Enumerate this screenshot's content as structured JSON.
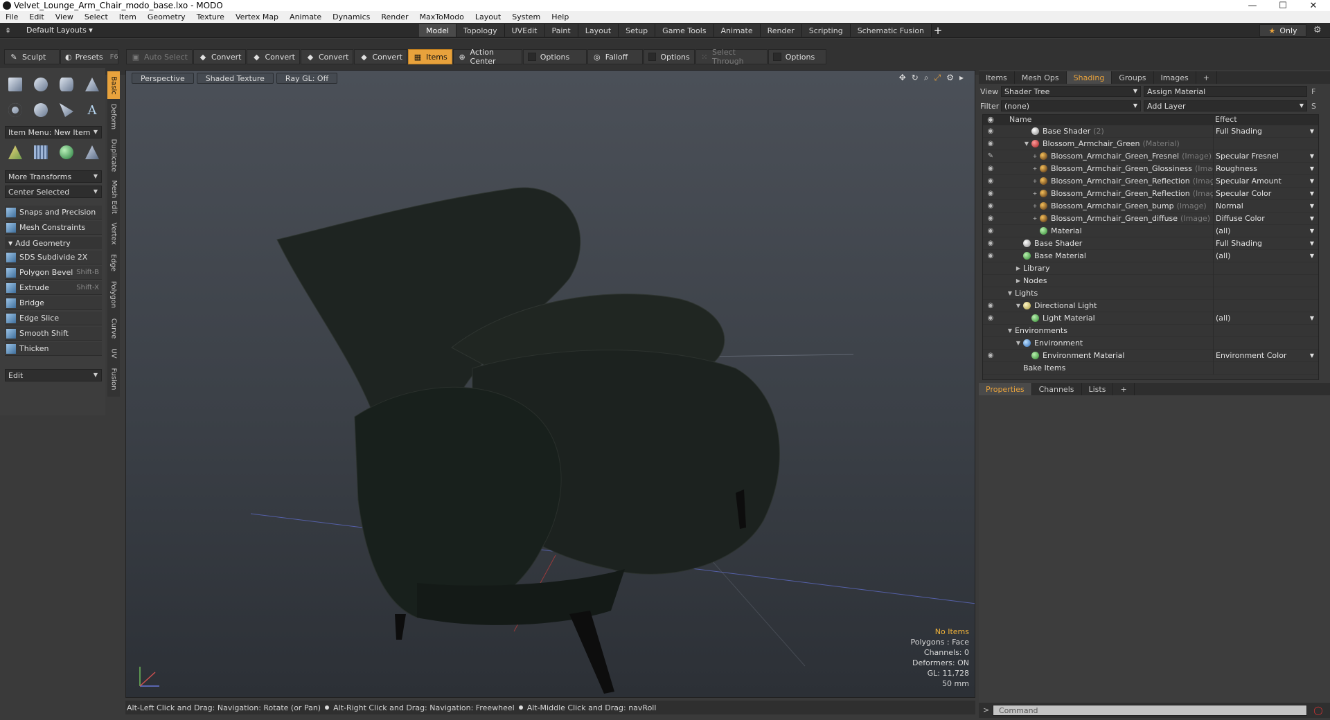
{
  "window": {
    "title": "Velvet_Lounge_Arm_Chair_modo_base.lxo - MODO",
    "controls": [
      "—",
      "☐",
      "✕"
    ]
  },
  "menu": [
    "File",
    "Edit",
    "View",
    "Select",
    "Item",
    "Geometry",
    "Texture",
    "Vertex Map",
    "Animate",
    "Dynamics",
    "Render",
    "MaxToModo",
    "Layout",
    "System",
    "Help"
  ],
  "layout_bar": {
    "default_layouts": "Default Layouts ▾",
    "tabs": [
      "Model",
      "Topology",
      "UVEdit",
      "Paint",
      "Layout",
      "Setup",
      "Game Tools",
      "Animate",
      "Render",
      "Scripting",
      "Schematic Fusion"
    ],
    "active_tab": "Model",
    "plus": "+",
    "only": "Only"
  },
  "toolbar": {
    "sculpt": "Sculpt",
    "presets": "Presets",
    "presets_hotkey": "F6",
    "auto_select": "Auto Select",
    "convert1": "Convert",
    "convert2": "Convert",
    "convert3": "Convert",
    "convert4": "Convert",
    "items": "Items",
    "action_center": "Action Center",
    "options1": "Options",
    "falloff": "Falloff",
    "options2": "Options",
    "select_through": "Select Through",
    "options3": "Options"
  },
  "left_panel": {
    "vertical_tabs": [
      "Basic",
      "Deform",
      "Duplicate",
      "Mesh Edit",
      "Vertex",
      "Edge",
      "Polygon",
      "Curve",
      "UV",
      "Fusion"
    ],
    "item_menu": "Item Menu: New Item",
    "more_transforms": "More Transforms",
    "center_selected": "Center Selected",
    "snaps": "Snaps and Precision",
    "mesh_constraints": "Mesh Constraints",
    "add_geometry": "Add Geometry",
    "tools": [
      {
        "label": "SDS Subdivide 2X",
        "hotkey": ""
      },
      {
        "label": "Polygon Bevel",
        "hotkey": "Shift-B"
      },
      {
        "label": "Extrude",
        "hotkey": "Shift-X"
      },
      {
        "label": "Bridge",
        "hotkey": ""
      },
      {
        "label": "Edge Slice",
        "hotkey": ""
      },
      {
        "label": "Smooth Shift",
        "hotkey": ""
      },
      {
        "label": "Thicken",
        "hotkey": ""
      }
    ],
    "edit": "Edit"
  },
  "viewport": {
    "perspective": "Perspective",
    "shaded_texture": "Shaded Texture",
    "ray_gl": "Ray GL: Off",
    "stats": {
      "no_items": "No Items",
      "polygons": "Polygons : Face",
      "channels": "Channels: 0",
      "deformers": "Deformers: ON",
      "gl": "GL: 11,728",
      "scale": "50 mm"
    }
  },
  "status_bar": {
    "hint1": "Alt-Left Click and Drag: Navigation: Rotate (or Pan)",
    "hint2": "Alt-Right Click and Drag: Navigation: Freewheel",
    "hint3": "Alt-Middle Click and Drag: navRoll"
  },
  "right_panel": {
    "tabs": [
      "Items",
      "Mesh Ops",
      "Shading",
      "Groups",
      "Images",
      "+"
    ],
    "active_tab": "Shading",
    "view_label": "View",
    "view_value": "Shader Tree",
    "assign_material": "Assign Material",
    "filter_label": "Filter",
    "filter_value": "(none)",
    "add_layer": "Add Layer",
    "col_name": "Name",
    "col_effect": "Effect",
    "tree": [
      {
        "name": "Base Shader",
        "tag": "(2)",
        "effect": "Full Shading",
        "indent": 2,
        "icon": "white",
        "twisty": "",
        "eye": "◉"
      },
      {
        "name": "Blossom_Armchair_Green",
        "tag": "(Material)",
        "effect": "",
        "indent": 2,
        "icon": "red",
        "twisty": "▼",
        "eye": "◉"
      },
      {
        "name": "Blossom_Armchair_Green_Fresnel",
        "tag": "(Image)",
        "effect": "Specular Fresnel",
        "indent": 3,
        "icon": "img",
        "twisty": "+",
        "eye": "✎"
      },
      {
        "name": "Blossom_Armchair_Green_Glossiness",
        "tag": "(Image)",
        "effect": "Roughness",
        "indent": 3,
        "icon": "img",
        "twisty": "+",
        "eye": "◉"
      },
      {
        "name": "Blossom_Armchair_Green_Reflection",
        "tag": "(Image...",
        "effect": "Specular Amount",
        "indent": 3,
        "icon": "img",
        "twisty": "+",
        "eye": "◉"
      },
      {
        "name": "Blossom_Armchair_Green_Reflection",
        "tag": "(Image)",
        "effect": "Specular Color",
        "indent": 3,
        "icon": "img",
        "twisty": "+",
        "eye": "◉"
      },
      {
        "name": "Blossom_Armchair_Green_bump",
        "tag": "(Image)",
        "effect": "Normal",
        "indent": 3,
        "icon": "img",
        "twisty": "+",
        "eye": "◉"
      },
      {
        "name": "Blossom_Armchair_Green_diffuse",
        "tag": "(Image)",
        "effect": "Diffuse Color",
        "indent": 3,
        "icon": "img",
        "twisty": "+",
        "eye": "◉"
      },
      {
        "name": "Material",
        "tag": "",
        "effect": "(all)",
        "indent": 3,
        "icon": "green",
        "twisty": "",
        "eye": "◉"
      },
      {
        "name": "Base Shader",
        "tag": "",
        "effect": "Full Shading",
        "indent": 1,
        "icon": "white",
        "twisty": "",
        "eye": "◉"
      },
      {
        "name": "Base Material",
        "tag": "",
        "effect": "(all)",
        "indent": 1,
        "icon": "green",
        "twisty": "",
        "eye": "◉"
      },
      {
        "name": "Library",
        "tag": "",
        "effect": "",
        "indent": 1,
        "icon": "",
        "twisty": "▶",
        "eye": ""
      },
      {
        "name": "Nodes",
        "tag": "",
        "effect": "",
        "indent": 1,
        "icon": "",
        "twisty": "▶",
        "eye": ""
      },
      {
        "name": "Lights",
        "tag": "",
        "effect": "",
        "indent": 0,
        "icon": "",
        "twisty": "▼",
        "eye": ""
      },
      {
        "name": "Directional Light",
        "tag": "",
        "effect": "",
        "indent": 1,
        "icon": "light",
        "twisty": "▼",
        "eye": "◉"
      },
      {
        "name": "Light Material",
        "tag": "",
        "effect": "(all)",
        "indent": 2,
        "icon": "green",
        "twisty": "",
        "eye": "◉"
      },
      {
        "name": "Environments",
        "tag": "",
        "effect": "",
        "indent": 0,
        "icon": "",
        "twisty": "▼",
        "eye": ""
      },
      {
        "name": "Environment",
        "tag": "",
        "effect": "",
        "indent": 1,
        "icon": "env",
        "twisty": "▼",
        "eye": ""
      },
      {
        "name": "Environment Material",
        "tag": "",
        "effect": "Environment Color",
        "indent": 2,
        "icon": "green",
        "twisty": "",
        "eye": "◉"
      },
      {
        "name": "Bake Items",
        "tag": "",
        "effect": "",
        "indent": 1,
        "icon": "",
        "twisty": "",
        "eye": ""
      }
    ],
    "props_tabs": [
      "Properties",
      "Channels",
      "Lists",
      "+"
    ],
    "active_props_tab": "Properties",
    "command_placeholder": "Command",
    "cmd_prompt": ">"
  }
}
